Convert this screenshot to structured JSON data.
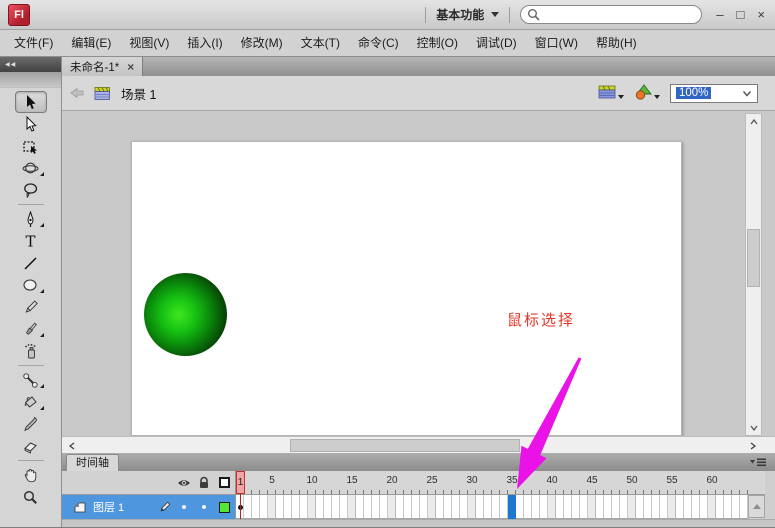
{
  "window": {
    "logo": "Fl",
    "workspace_label": "基本功能",
    "search_value": "",
    "controls": {
      "minimize": "–",
      "maximize": "□",
      "close": "×"
    }
  },
  "menubar": {
    "items": [
      {
        "label": "文件(F)"
      },
      {
        "label": "编辑(E)"
      },
      {
        "label": "视图(V)"
      },
      {
        "label": "插入(I)"
      },
      {
        "label": "修改(M)"
      },
      {
        "label": "文本(T)"
      },
      {
        "label": "命令(C)"
      },
      {
        "label": "控制(O)"
      },
      {
        "label": "调试(D)"
      },
      {
        "label": "窗口(W)"
      },
      {
        "label": "帮助(H)"
      }
    ]
  },
  "document": {
    "tab_title": "未命名-1*",
    "tab_close": "×"
  },
  "editbar": {
    "scene_label": "场景 1",
    "zoom_value": "100%"
  },
  "toolbar": {
    "tools": [
      {
        "name": "selection-tool",
        "selected": true
      },
      {
        "name": "subselection-tool"
      },
      {
        "name": "free-transform-tool"
      },
      {
        "name": "3d-rotation-tool"
      },
      {
        "name": "lasso-tool"
      },
      {
        "name": "pen-tool"
      },
      {
        "name": "text-tool"
      },
      {
        "name": "line-tool"
      },
      {
        "name": "oval-tool"
      },
      {
        "name": "pencil-tool"
      },
      {
        "name": "brush-tool"
      },
      {
        "name": "deco-tool"
      },
      {
        "name": "bone-tool"
      },
      {
        "name": "paint-bucket-tool"
      },
      {
        "name": "eyedropper-tool"
      },
      {
        "name": "eraser-tool"
      },
      {
        "name": "hand-tool"
      },
      {
        "name": "zoom-tool"
      }
    ]
  },
  "stage": {
    "ball": {
      "center_color": "#2ee20e",
      "edge_color": "#021402"
    }
  },
  "annotation": {
    "label": "鼠标选择",
    "text_color": "#e23726",
    "arrow_color": "#ea12e6"
  },
  "timeline": {
    "panel_tab": "时间轴",
    "layer_name": "图层 1",
    "playhead_frame": "1",
    "selected_frame": 35,
    "ruler_labels": [
      "5",
      "10",
      "15",
      "20",
      "25",
      "30",
      "35",
      "40",
      "45",
      "50",
      "55",
      "60"
    ],
    "colors": {
      "selected_layer": "#4e96dd",
      "selected_frame": "#1e78d0",
      "playhead": "#c23030",
      "layer_outline_color": "#55e636"
    }
  }
}
